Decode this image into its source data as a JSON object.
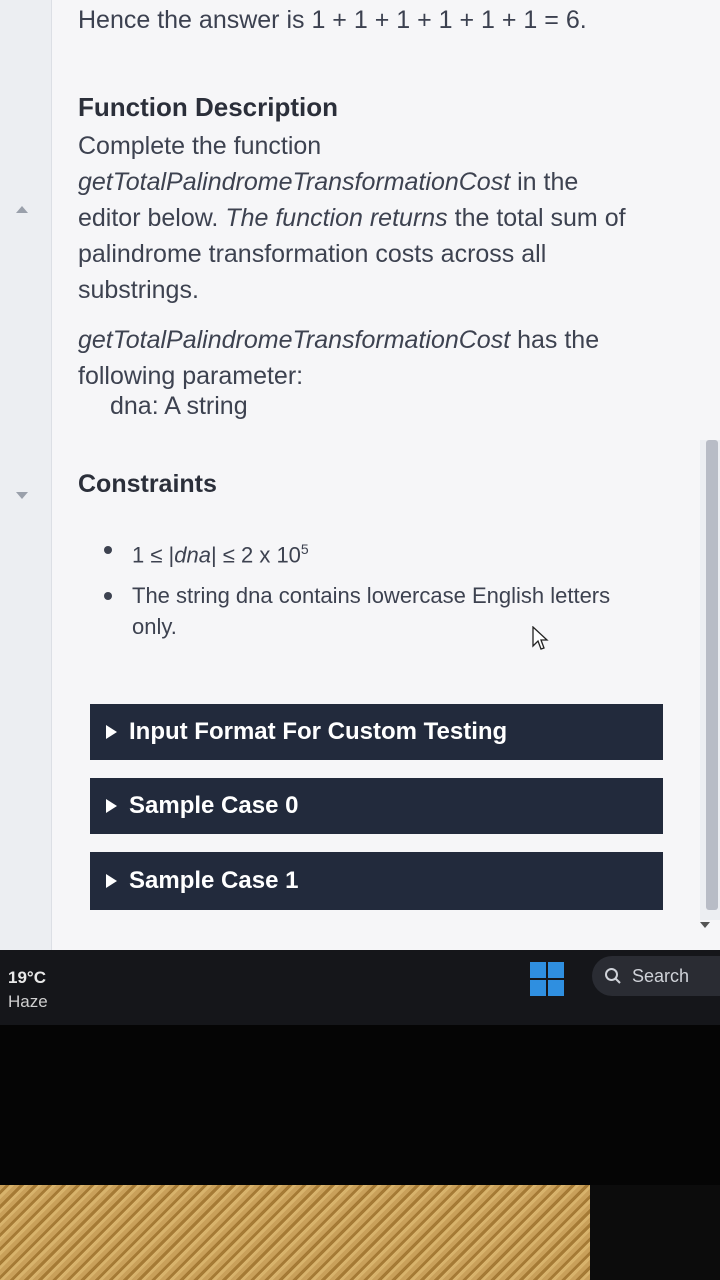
{
  "answer_line": "Hence the answer is 1 + 1 + 1 + 1 + 1 + 1 = 6.",
  "function_description": {
    "title": "Function Description",
    "line1": "Complete the function",
    "func_name": "getTotalPalindromeTransformationCost",
    "line2_suffix": " in the",
    "line3_a": "editor below. ",
    "line3_b": "The function returns",
    "line3_c": " the total sum of",
    "line4": "palindrome transformation costs across all",
    "line5": "substrings.",
    "func_name_2": "getTotalPalindromeTransformationCost",
    "has_the": " has the",
    "line7": "following parameter:",
    "param_name": "dna:",
    "param_desc": " A string"
  },
  "constraints": {
    "title": "Constraints",
    "item1_prefix": "1 ≤ |",
    "item1_var": "dna",
    "item1_mid": "| ≤ 2 x 10",
    "item1_exp": "5",
    "item2_line1": "The string dna contains lowercase English letters",
    "item2_line2": "only."
  },
  "accordions": [
    {
      "label": "Input Format For Custom Testing"
    },
    {
      "label": "Sample Case 0"
    },
    {
      "label": "Sample Case 1"
    }
  ],
  "taskbar": {
    "temperature": "19°C",
    "condition": "Haze",
    "search_label": "Search"
  },
  "colors": {
    "accordion_bg": "#222a3c",
    "windows_blue": "#2f8fe0",
    "page_bg": "#f6f6f8"
  }
}
